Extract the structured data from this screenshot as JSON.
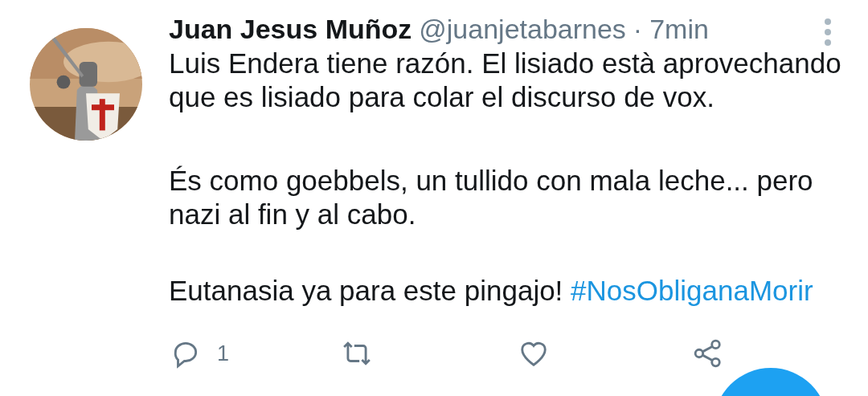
{
  "tweet": {
    "author": {
      "name": "Juan Jesus Muñoz",
      "handle": "@juanjetabarnes",
      "separator": "·",
      "time": "7min"
    },
    "paragraphs": [
      {
        "text": "Luis Endera tiene razón. El lisiado està aprovechando que es lisiado para colar el discurso de vox."
      },
      {
        "text": "És como goebbels, un tullido con mala leche... pero nazi al fin y al cabo."
      },
      {
        "text": "Eutanasia ya para este pingajo! ",
        "hashtag": "#NosObliganaMorir"
      }
    ],
    "actions": [
      {
        "kind": "reply",
        "count": "1"
      },
      {
        "kind": "retweet"
      },
      {
        "kind": "like"
      },
      {
        "kind": "share"
      }
    ]
  },
  "fab": {
    "kind": "compose"
  }
}
